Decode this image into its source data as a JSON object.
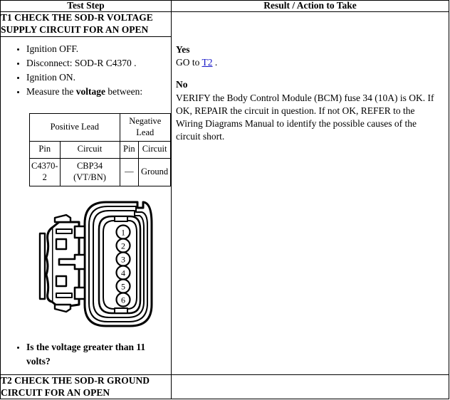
{
  "table": {
    "headers": {
      "step": "Test Step",
      "result": "Result / Action to Take"
    }
  },
  "t1": {
    "title": "T1 CHECK THE SOD-R VOLTAGE SUPPLY CIRCUIT FOR AN OPEN",
    "steps": [
      "Ignition OFF.",
      "Disconnect: SOD-R C4370 .",
      "Ignition ON.",
      "Measure the voltage between:"
    ],
    "step_4_prefix": "Measure the ",
    "step_4_bold": "voltage",
    "step_4_suffix": " between:",
    "question": "Is the voltage greater than 11 volts?",
    "pin_table": {
      "group_headers": {
        "positive": "Positive Lead",
        "negative": "Negative Lead"
      },
      "sub_headers": {
        "pos_pin": "Pin",
        "pos_circuit": "Circuit",
        "neg_pin": "Pin",
        "neg_circuit": "Circuit"
      },
      "rows": [
        {
          "pos_pin": "C4370-2",
          "pos_circuit": "CBP34 (VT/BN)",
          "pos_circuit_line1": "CBP34",
          "pos_circuit_line2": "(VT/BN)",
          "pos_pin_line1": "C4370-",
          "pos_pin_line2": "2",
          "neg_pin": "—",
          "neg_circuit": "Ground"
        }
      ]
    },
    "connector": {
      "name": "sod-r-connector-c4370",
      "pin_count": 6,
      "pin_labels": [
        "1",
        "2",
        "3",
        "4",
        "5",
        "6"
      ]
    },
    "result": {
      "yes_label": "Yes",
      "yes_text_prefix": "GO to ",
      "yes_link": "T2",
      "yes_text_suffix": " .",
      "no_label": "No",
      "no_text": "VERIFY the Body Control Module (BCM) fuse 34 (10A) is OK. If OK, REPAIR the circuit in question. If not OK, REFER to the Wiring Diagrams Manual to identify the possible causes of the circuit short."
    }
  },
  "t2": {
    "title": "T2 CHECK THE SOD-R GROUND CIRCUIT FOR AN OPEN"
  },
  "colors": {
    "link": "#1515c8",
    "border": "#000000",
    "text": "#000000",
    "background": "#ffffff"
  }
}
